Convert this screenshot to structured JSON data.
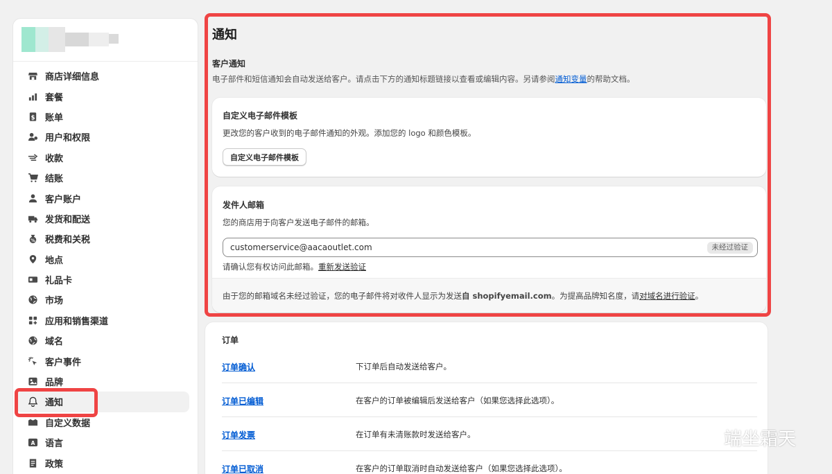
{
  "sidebar": {
    "items": [
      {
        "label": "商店详细信息",
        "icon": "store-icon"
      },
      {
        "label": "套餐",
        "icon": "plan-icon"
      },
      {
        "label": "账单",
        "icon": "billing-icon"
      },
      {
        "label": "用户和权限",
        "icon": "users-icon"
      },
      {
        "label": "收款",
        "icon": "payments-icon"
      },
      {
        "label": "结账",
        "icon": "cart-icon"
      },
      {
        "label": "客户账户",
        "icon": "person-icon"
      },
      {
        "label": "发货和配送",
        "icon": "truck-icon"
      },
      {
        "label": "税费和关税",
        "icon": "tax-icon"
      },
      {
        "label": "地点",
        "icon": "location-icon"
      },
      {
        "label": "礼品卡",
        "icon": "gift-card-icon"
      },
      {
        "label": "市场",
        "icon": "globe-icon"
      },
      {
        "label": "应用和销售渠道",
        "icon": "apps-icon"
      },
      {
        "label": "域名",
        "icon": "domain-icon"
      },
      {
        "label": "客户事件",
        "icon": "cursor-icon"
      },
      {
        "label": "品牌",
        "icon": "brand-icon"
      },
      {
        "label": "通知",
        "icon": "bell-icon",
        "active": true
      },
      {
        "label": "自定义数据",
        "icon": "data-icon"
      },
      {
        "label": "语言",
        "icon": "language-icon"
      },
      {
        "label": "政策",
        "icon": "policy-icon"
      }
    ]
  },
  "main": {
    "title": "通知",
    "customer_notifications": {
      "title": "客户通知",
      "desc_before": "电子部件和短信通知会自动发送给客户。请点击下方的通知标题链接以查看或编辑内容。另请参阅",
      "desc_link": "通知变量",
      "desc_after": "的帮助文档。"
    },
    "email_template": {
      "title": "自定义电子邮件模板",
      "desc": "更改您的客户收到的电子邮件通知的外观。添加您的 logo 和颜色模板。",
      "button": "自定义电子邮件模板"
    },
    "sender_email": {
      "title": "发件人邮箱",
      "desc": "您的商店用于向客户发送电子邮件的邮箱。",
      "value": "customerservice@aacaoutlet.com",
      "badge": "未经过验证",
      "verify_text": "请确认您有权访问此邮箱。",
      "verify_link": "重新发送验证",
      "footer_before": "由于您的邮箱域名未经过验证，您的电子邮件将对收件人显示为发送",
      "footer_bold": "自 shopifyemail.com",
      "footer_mid": "。为提高品牌知名度，请",
      "footer_link": "对域名进行验证",
      "footer_after": "。"
    },
    "orders": {
      "title": "订单",
      "rows": [
        {
          "name": "订单确认",
          "desc": "下订单后自动发送给客户。"
        },
        {
          "name": "订单已编辑",
          "desc": "在客户的订单被编辑后发送给客户（如果您选择此选项）。"
        },
        {
          "name": "订单发票",
          "desc": "在订单有未清账款时发送给客户。"
        },
        {
          "name": "订单已取消",
          "desc": "在客户的订单取消时自动发送给客户（如果您选择此选项）。"
        }
      ]
    }
  },
  "watermark": {
    "text": "端坐霜天",
    "icon": "wechat-icon"
  },
  "colors": {
    "highlight": "#ef4444",
    "link": "#005bd3",
    "background": "#f1f1f1"
  }
}
